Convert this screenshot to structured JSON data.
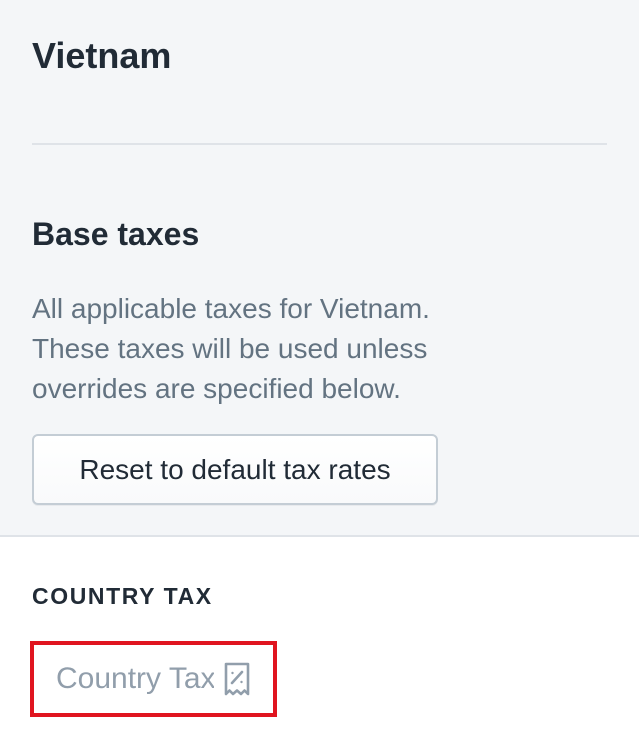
{
  "header": {
    "title": "Vietnam"
  },
  "base_taxes": {
    "heading": "Base taxes",
    "description": "All applicable taxes for Vietnam. These taxes will be used unless overrides are specified below.",
    "reset_label": "Reset to default tax rates"
  },
  "country_tax": {
    "label": "COUNTRY TAX",
    "placeholder": "Country Tax",
    "icon": "receipt-percent-icon"
  },
  "colors": {
    "panel_bg": "#f4f6f8",
    "text_primary": "#212b36",
    "text_subdued": "#637381",
    "placeholder": "#919eab",
    "highlight": "#e0151f"
  }
}
